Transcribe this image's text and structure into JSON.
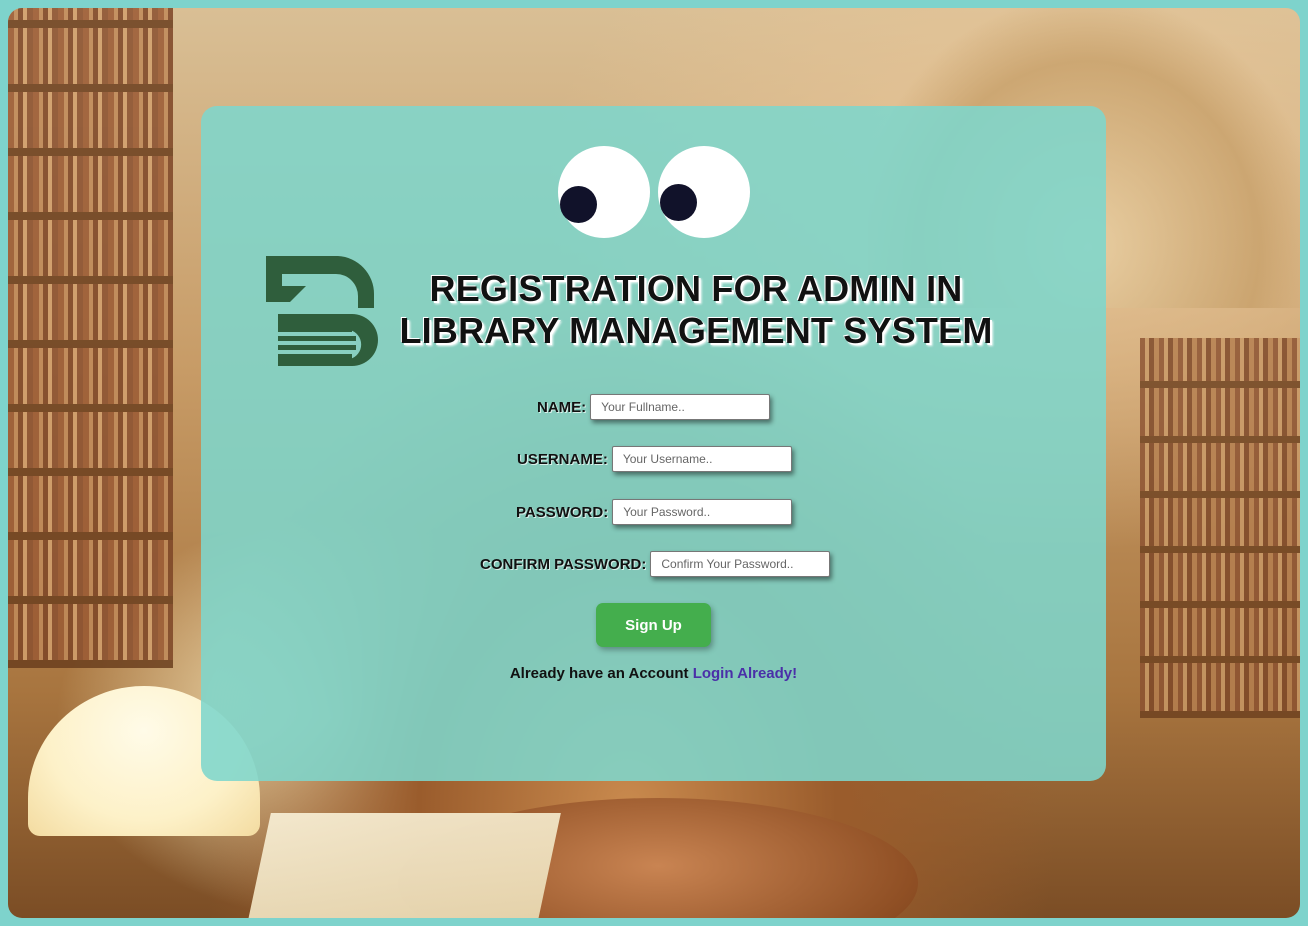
{
  "page": {
    "title_line1": "REGISTRATION FOR ADMIN IN",
    "title_line2": "LIBRARY MANAGEMENT SYSTEM"
  },
  "form": {
    "name": {
      "label": "NAME:",
      "placeholder": "Your Fullname..",
      "value": ""
    },
    "username": {
      "label": "USERNAME:",
      "placeholder": "Your Username..",
      "value": ""
    },
    "password": {
      "label": "PASSWORD:",
      "placeholder": "Your Password..",
      "value": ""
    },
    "confirm_password": {
      "label": "CONFIRM PASSWORD:",
      "placeholder": "Confirm Your Password..",
      "value": ""
    },
    "submit_label": "Sign Up"
  },
  "footer": {
    "prompt": "Already have an Account ",
    "login_link": "Login Already!"
  },
  "colors": {
    "card": "#7ed6cc",
    "button": "#44ae4d",
    "link": "#4a2fa8",
    "logo": "#2f5e3c"
  }
}
